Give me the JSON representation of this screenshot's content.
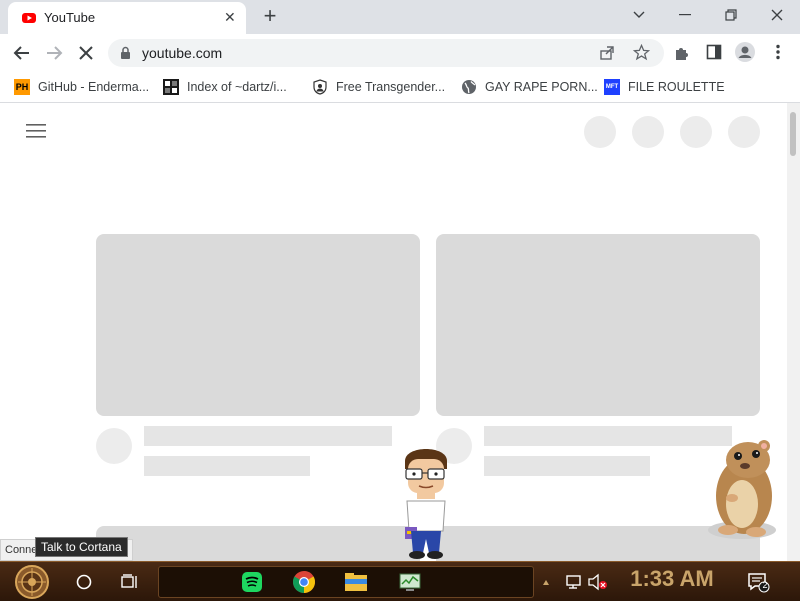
{
  "browser": {
    "tab_title": "YouTube",
    "url": "youtube.com",
    "bookmarks": [
      {
        "label": "GitHub - Enderma...",
        "icon": "ph-icon"
      },
      {
        "label": "Index of ~dartz/i...",
        "icon": "index-icon"
      },
      {
        "label": "Free Transgender...",
        "icon": "user-shield-icon"
      },
      {
        "label": "GAY RAPE PORN...",
        "icon": "globe-icon"
      },
      {
        "label": "FILE ROULETTE",
        "icon": "mft-icon"
      }
    ],
    "ph_icon_text": "PH",
    "mft_icon_text": "MFT"
  },
  "taskbar": {
    "clock": "1:33 AM",
    "notification_count": "2",
    "cortana_tooltip": "Talk to Cortana",
    "connect_text": "Conne"
  },
  "colors": {
    "youtube_red": "#ff0000",
    "chrome_frame": "#dee1e6",
    "taskbar_brown": "#3a1f0d",
    "clock_gold": "#c9a46a"
  }
}
